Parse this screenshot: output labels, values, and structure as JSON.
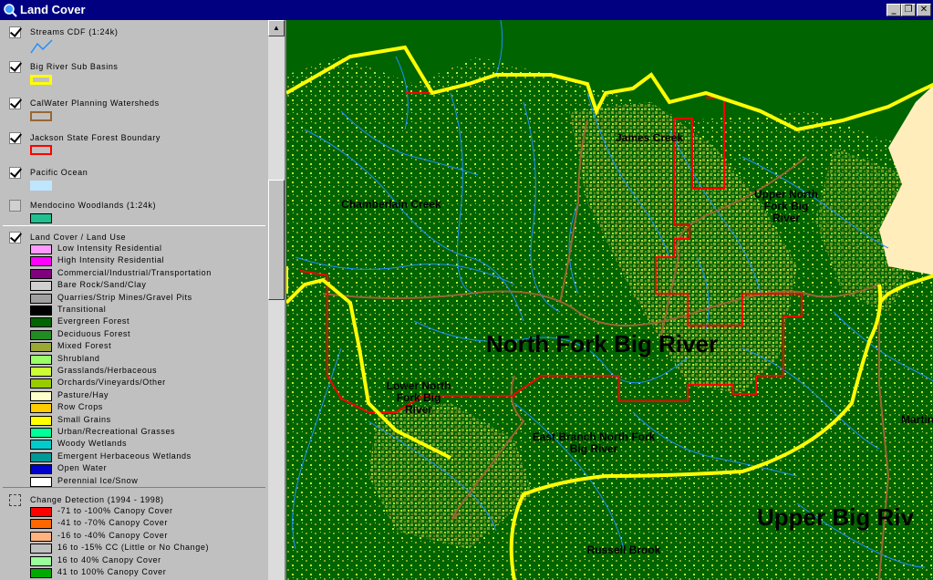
{
  "window": {
    "title": "Land Cover",
    "minimize": "_",
    "restore": "❐",
    "close": "✕"
  },
  "toc": {
    "layers": [
      {
        "name": "Streams CDF (1:24k)",
        "checked": true,
        "symbol": "stream-line"
      },
      {
        "name": "Big River Sub Basins",
        "checked": true,
        "symbol": "outline",
        "color": "#ffff00"
      },
      {
        "name": "CalWater Planning Watersheds",
        "checked": true,
        "symbol": "outline",
        "color": "#996633"
      },
      {
        "name": "Jackson State Forest Boundary",
        "checked": true,
        "symbol": "outline",
        "color": "#ff0000"
      },
      {
        "name": "Pacific Ocean",
        "checked": true,
        "symbol": "fill",
        "color": "#bfe6ff"
      },
      {
        "name": "Mendocino Woodlands (1:24k)",
        "checked": false,
        "symbol": "fill",
        "color": "#20c090"
      },
      {
        "name": "Land Cover / Land Use",
        "checked": true,
        "symbol": "classes"
      },
      {
        "name": "Change Detection (1994 - 1998)",
        "checked": false,
        "symbol": "classes"
      }
    ],
    "landcover_classes": [
      {
        "label": "Low Intensity Residential",
        "color": "#ff99ff"
      },
      {
        "label": "High Intensity Residential",
        "color": "#ff00ff"
      },
      {
        "label": "Commercial/Industrial/Transportation",
        "color": "#800080"
      },
      {
        "label": "Bare Rock/Sand/Clay",
        "color": "#d0d0d0"
      },
      {
        "label": "Quarries/Strip Mines/Gravel Pits",
        "color": "#a0a0a0"
      },
      {
        "label": "Transitional",
        "color": "#000000"
      },
      {
        "label": "Evergreen Forest",
        "color": "#006400"
      },
      {
        "label": "Deciduous Forest",
        "color": "#228b22"
      },
      {
        "label": "Mixed Forest",
        "color": "#9aa834"
      },
      {
        "label": "Shrubland",
        "color": "#99ff66"
      },
      {
        "label": "Grasslands/Herbaceous",
        "color": "#ccff33"
      },
      {
        "label": "Orchards/Vineyards/Other",
        "color": "#99cc00"
      },
      {
        "label": "Pasture/Hay",
        "color": "#ffffcc"
      },
      {
        "label": "Row Crops",
        "color": "#ffcc00"
      },
      {
        "label": "Small Grains",
        "color": "#ffff00"
      },
      {
        "label": "Urban/Recreational Grasses",
        "color": "#00ff99"
      },
      {
        "label": "Woody Wetlands",
        "color": "#00cccc"
      },
      {
        "label": "Emergent Herbaceous Wetlands",
        "color": "#009999"
      },
      {
        "label": "Open Water",
        "color": "#0000cc"
      },
      {
        "label": "Perennial Ice/Snow",
        "color": "#ffffff"
      }
    ],
    "change_classes": [
      {
        "label": "-71 to -100% Canopy Cover",
        "color": "#ff0000"
      },
      {
        "label": "-41 to -70% Canopy Cover",
        "color": "#ff6600"
      },
      {
        "label": "-16 to -40% Canopy Cover",
        "color": "#ffb380"
      },
      {
        "label": "16 to -15% CC (Little or No Change)",
        "color": "#c0c0c0"
      },
      {
        "label": "16 to 40% Canopy Cover",
        "color": "#99ff99"
      },
      {
        "label": "41 to 100% Canopy Cover",
        "color": "#00aa00"
      }
    ]
  },
  "map": {
    "labels": {
      "james_creek": "James Creek",
      "chamberlain_creek": "Chamberlain Creek",
      "upper_nf_1": "Upper North",
      "upper_nf_2": "Fork Big",
      "upper_nf_3": "River",
      "north_fork": "North Fork Big River",
      "lower_nf_1": "Lower North",
      "lower_nf_2": "Fork Big",
      "lower_nf_3": "River",
      "east_branch_1": "East Branch North Fork",
      "east_branch_2": "Big River",
      "upper_big": "Upper Big Riv",
      "martin": "Martin",
      "russell_brook": "Russell Brook"
    },
    "colors": {
      "forest": "#006400",
      "mixed": "#9aa834",
      "grass": "#ccff33",
      "stream": "#1e90ff",
      "subbasin": "#ffff00",
      "watershed": "#996633",
      "jackson": "#ff0000",
      "ocean": "#ffeebb"
    }
  }
}
